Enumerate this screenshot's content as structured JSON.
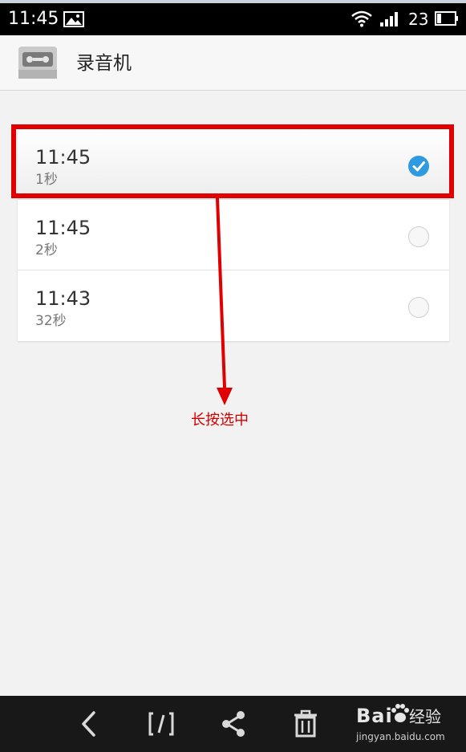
{
  "status_bar": {
    "time": "11:45",
    "battery": "23",
    "icons": [
      "image-icon",
      "wifi-icon",
      "signal-icon",
      "battery-icon"
    ]
  },
  "app_bar": {
    "title": "录音机",
    "icon": "cassette-icon"
  },
  "recordings": [
    {
      "time": "11:45",
      "duration": "1秒",
      "selected": true
    },
    {
      "time": "11:45",
      "duration": "2秒",
      "selected": false
    },
    {
      "time": "11:43",
      "duration": "32秒",
      "selected": false
    }
  ],
  "annotation": {
    "label": "长按选中",
    "color": "#e00000"
  },
  "toolbar": {
    "buttons": [
      "back-icon",
      "rename-icon",
      "share-icon",
      "delete-icon"
    ]
  },
  "watermark": {
    "main": "Bai",
    "cn": "经验",
    "url": "jingyan.baidu.com"
  },
  "colors": {
    "accent": "#2e9ae0",
    "annotation": "#e00000",
    "background": "#f2f2f2"
  }
}
